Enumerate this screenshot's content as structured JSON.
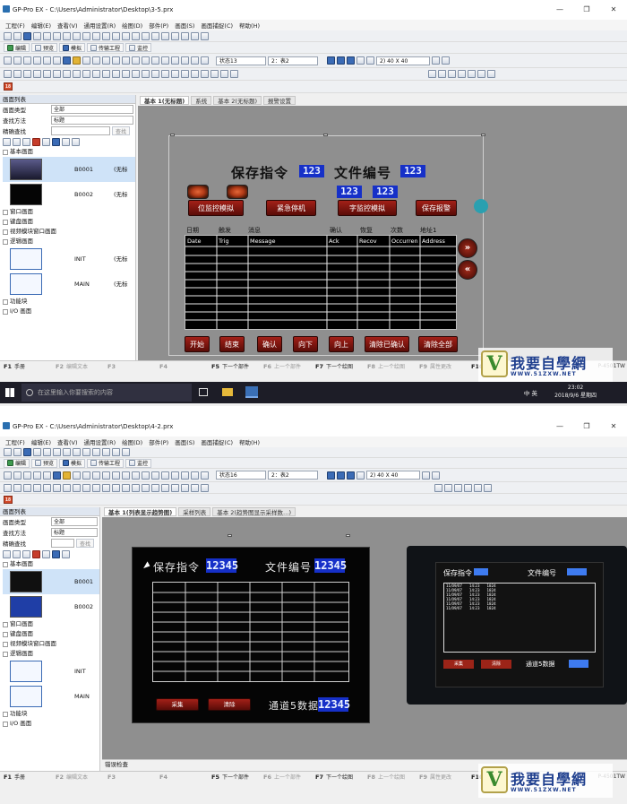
{
  "top": {
    "title": "GP-Pro EX - C:\\Users\\Administrator\\Desktop\\3-5.prx",
    "menu": [
      "工程(F)",
      "编辑(E)",
      "查看(V)",
      "通用设置(R)",
      "绘图(D)",
      "部件(P)",
      "画面(S)",
      "画面捕捉(C)",
      "帮助(H)"
    ],
    "modes": [
      "编辑",
      "预览",
      "模拟",
      "传输工程",
      "监控"
    ],
    "state_select": "状态13",
    "table_select": "2：表2",
    "grid_select": "2) 40 X 40",
    "sidebar": {
      "header": "画面列表",
      "screen_type_label": "画面类型",
      "screen_type_value": "全部",
      "search_method_label": "查找方法",
      "search_method_value": "标题",
      "exact_search_label": "精确查找",
      "search_button": "查找",
      "group_base": "基本画面",
      "screens": [
        {
          "id": "B0001",
          "name": "(无标"
        },
        {
          "id": "B0002",
          "name": "(无标"
        }
      ],
      "group_window": "窗口画面",
      "group_keyboard": "键盘画面",
      "group_video": "视频模块窗口画面",
      "group_logic": "逻辑画面",
      "logic": [
        {
          "id": "INIT",
          "name": "(无标"
        },
        {
          "id": "MAIN",
          "name": "(无标"
        }
      ],
      "group_func": "功能块",
      "group_io": "I/O 画面"
    },
    "tabs": [
      "基本 1(无标题)",
      "系统",
      "基本 2(无标题)",
      "报警设置"
    ],
    "hmi": {
      "save_cmd": "保存指令",
      "save_num": "123",
      "file_no": "文件编号",
      "file_num": "123",
      "num_a": "123",
      "num_b": "123",
      "btn_sim": "位监控模拟",
      "btn_estop": "紧急停机",
      "btn_wsim": "字监控模拟",
      "btn_report": "保存报警",
      "lbl_date": "日期",
      "lbl_trig": "触发",
      "lbl_msg": "消息",
      "lbl_ack": "确认",
      "lbl_recov": "恢复",
      "lbl_count": "次数",
      "lbl_addr": "地址1",
      "cols": [
        "Date",
        "Trig",
        "Message",
        "Ack",
        "Recov",
        "Occurren",
        "Address"
      ],
      "nav_next": "»",
      "nav_prev": "«",
      "bottom": [
        "开始",
        "结束",
        "确认",
        "向下",
        "向上",
        "清除已确认",
        "清除全部"
      ]
    },
    "fkeys": [
      {
        "k": "F1",
        "t": "手册"
      },
      {
        "k": "F2",
        "t": "编辑文本"
      },
      {
        "k": "F3",
        "t": ""
      },
      {
        "k": "F4",
        "t": ""
      },
      {
        "k": "F5",
        "t": "下一个部件"
      },
      {
        "k": "F6",
        "t": "上一个部件"
      },
      {
        "k": "F7",
        "t": "下一个绘图"
      },
      {
        "k": "F8",
        "t": "上一个绘图"
      },
      {
        "k": "F9",
        "t": "属性更改"
      },
      {
        "k": "F10",
        "t": ""
      }
    ],
    "model": "P-4501TW",
    "taskbar": {
      "search": "在这里输入你要搜索的内容",
      "ime": "中 英",
      "time": "23:02",
      "date": "2018/9/6 星期四"
    }
  },
  "bottom": {
    "title": "GP-Pro EX - C:\\Users\\Administrator\\Desktop\\4-2.prx",
    "state_select": "状态16",
    "table_select": "2：表2",
    "grid_select": "2) 40 X 40",
    "tabs": [
      "基本 1(列表显示趋势图)",
      "采样列表",
      "基本 2(趋势图显示采样数…)"
    ],
    "hmi": {
      "save_cmd": "保存指令",
      "save_num": "12345",
      "file_no": "文件编号",
      "file_num": "12345",
      "btn_collect": "采集",
      "btn_clear": "清除",
      "channel5": "通道5数据",
      "channel5_num": "12345"
    },
    "photo": {
      "save_cmd": "保存指令",
      "file_no": "文件编号",
      "rows": [
        [
          "11/09/07",
          "14:23",
          "1824"
        ],
        [
          "11/09/07",
          "14:23",
          "1824"
        ],
        [
          "11/09/07",
          "14:23",
          "1824"
        ],
        [
          "11/09/07",
          "14:23",
          "1824"
        ],
        [
          "11/09/07",
          "14:23",
          "1824"
        ],
        [
          "11/09/07",
          "14:23",
          "1824"
        ]
      ],
      "btn_collect": "采集",
      "btn_clear": "清除",
      "channel5": "通道5数据"
    },
    "error_panel": "错误检查"
  },
  "watermark": {
    "name": "我要自學網",
    "url": "WWW.51ZXW.NET"
  }
}
